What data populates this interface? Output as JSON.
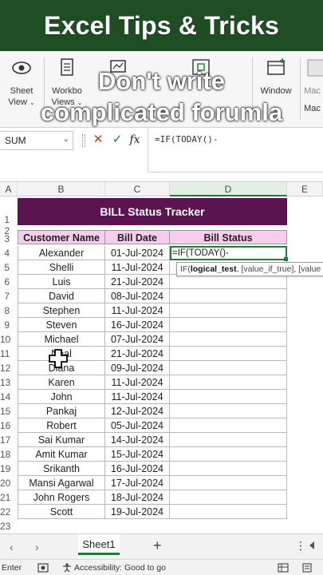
{
  "banner": {
    "title": "Excel Tips & Tricks"
  },
  "overlay": {
    "line1": "Don't write",
    "line2": "complicated forumla"
  },
  "ribbon": {
    "sheet_view": "Sheet",
    "sheet_view2": "View",
    "workbook_views": "Workbo",
    "workbook_views2": "Views",
    "window": "Window",
    "macros": "Mac",
    "macros2": "Mac"
  },
  "formula_bar": {
    "name_box": "SUM",
    "fx": "fx",
    "formula": "=IF(TODAY()-"
  },
  "grid": {
    "columns": [
      "A",
      "B",
      "C",
      "D",
      "E"
    ],
    "title": "BILL Status Tracker",
    "headers": [
      "Customer Name",
      "Bill Date",
      "Bill Status"
    ],
    "row_numbers": [
      "1",
      "2",
      "3",
      "4",
      "5",
      "6",
      "7",
      "8",
      "9",
      "10",
      "11",
      "12",
      "13",
      "14",
      "15",
      "16",
      "17",
      "18",
      "19",
      "20",
      "21",
      "22",
      "23"
    ],
    "rows": [
      {
        "name": "Alexander",
        "date": "01-Jul-2024"
      },
      {
        "name": "Shelli",
        "date": "11-Jul-2024"
      },
      {
        "name": "Luis",
        "date": "21-Jul-2024"
      },
      {
        "name": "David",
        "date": "08-Jul-2024"
      },
      {
        "name": "Stephen",
        "date": "11-Jul-2024"
      },
      {
        "name": "Steven",
        "date": "16-Jul-2024"
      },
      {
        "name": "Michael",
        "date": "07-Jul-2024"
      },
      {
        "name": "Neal",
        "date": "21-Jul-2024"
      },
      {
        "name": "Diana",
        "date": "09-Jul-2024"
      },
      {
        "name": "Karen",
        "date": "11-Jul-2024"
      },
      {
        "name": "John",
        "date": "11-Jul-2024"
      },
      {
        "name": "Pankaj",
        "date": "12-Jul-2024"
      },
      {
        "name": "Robert",
        "date": "05-Jul-2024"
      },
      {
        "name": "Sai Kumar",
        "date": "14-Jul-2024"
      },
      {
        "name": "Amit Kumar",
        "date": "15-Jul-2024"
      },
      {
        "name": "Srikanth",
        "date": "16-Jul-2024"
      },
      {
        "name": "Mansi Agarwal",
        "date": "17-Jul-2024"
      },
      {
        "name": "John Rogers",
        "date": "18-Jul-2024"
      },
      {
        "name": "Scott",
        "date": "19-Jul-2024"
      }
    ],
    "active_cell_text": "=IF(TODAY()-",
    "tooltip": {
      "fn": "IF(",
      "arg1": "logical_test",
      "rest": ", [value_if_true], [value"
    }
  },
  "tabs": {
    "sheet1": "Sheet1"
  },
  "status": {
    "mode": "Enter",
    "accessibility": "Accessibility: Good to go"
  },
  "colors": {
    "banner": "#1f4d24",
    "title_bar": "#5a1450",
    "header_fill": "#f6cdeb",
    "accent": "#1e7b3a"
  }
}
